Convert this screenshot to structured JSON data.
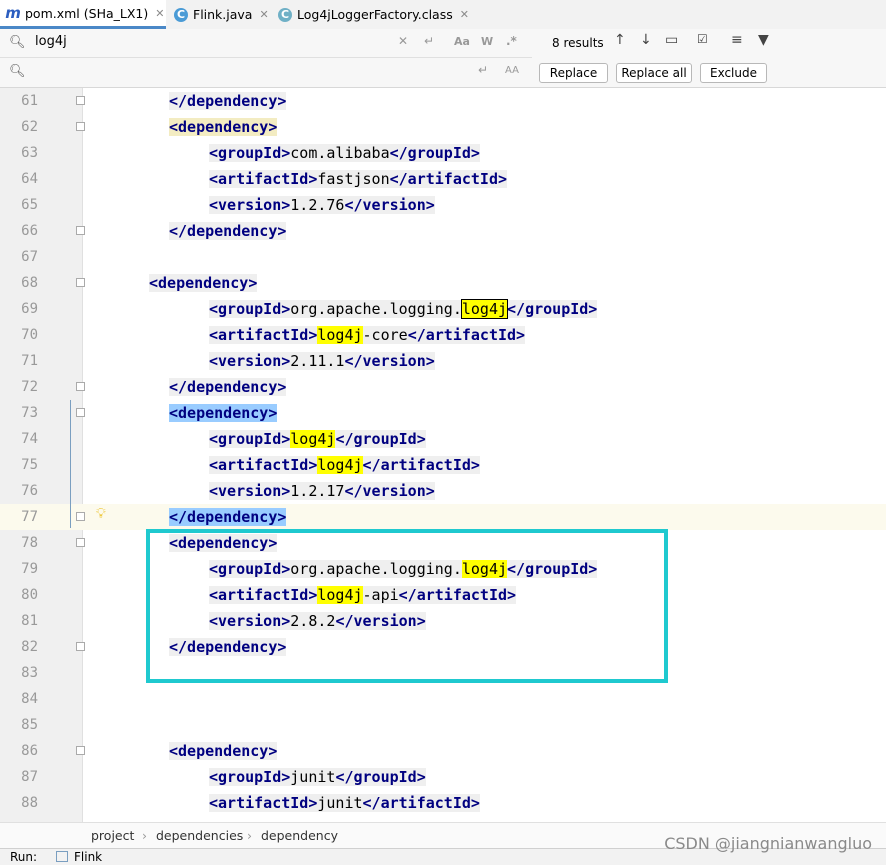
{
  "tabs": [
    {
      "icon": "m",
      "label": "pom.xml (SHa_LX1)",
      "active": true
    },
    {
      "icon": "C",
      "label": "Flink.java",
      "active": false
    },
    {
      "icon": "C",
      "label": "Log4jLoggerFactory.class",
      "active": false
    }
  ],
  "search": {
    "find_value": "log4j",
    "replace_value": "",
    "results": "8 results",
    "match_case": "Aa",
    "words": "W",
    "regex": ".*",
    "preserve_case": "AA",
    "replace_label": "Replace",
    "replace_all_label": "Replace all",
    "exclude_label": "Exclude"
  },
  "editor": {
    "lines": [
      {
        "n": "61",
        "indent": 1,
        "t": [
          [
            "tag",
            "</dependency>"
          ]
        ]
      },
      {
        "n": "62",
        "indent": 1,
        "t": [
          [
            "tagp",
            "<dependency>"
          ]
        ]
      },
      {
        "n": "63",
        "indent": 2,
        "t": [
          [
            "tag",
            "<groupId>"
          ],
          [
            "txt",
            "com.alibaba"
          ],
          [
            "tag",
            "</groupId>"
          ]
        ]
      },
      {
        "n": "64",
        "indent": 2,
        "t": [
          [
            "tag",
            "<artifactId>"
          ],
          [
            "txt",
            "fastjson"
          ],
          [
            "tag",
            "</artifactId>"
          ]
        ]
      },
      {
        "n": "65",
        "indent": 2,
        "t": [
          [
            "tag",
            "<version>"
          ],
          [
            "txt",
            "1.2.76"
          ],
          [
            "tag",
            "</version>"
          ]
        ]
      },
      {
        "n": "66",
        "indent": 1,
        "t": [
          [
            "tag",
            "</dependency>"
          ]
        ]
      },
      {
        "n": "67",
        "indent": 0,
        "t": []
      },
      {
        "n": "68",
        "indent": 0,
        "t": [
          [
            "tag",
            "<dependency>"
          ]
        ]
      },
      {
        "n": "69",
        "indent": 2,
        "t": [
          [
            "tag",
            "<groupId>"
          ],
          [
            "txt",
            "org.apache.logging."
          ],
          [
            "hlb",
            "log4j"
          ],
          [
            "tag",
            "</groupId>"
          ]
        ]
      },
      {
        "n": "70",
        "indent": 2,
        "t": [
          [
            "tag",
            "<artifactId>"
          ],
          [
            "hl",
            "log4j"
          ],
          [
            "txt",
            "-core"
          ],
          [
            "tag",
            "</artifactId>"
          ]
        ]
      },
      {
        "n": "71",
        "indent": 2,
        "t": [
          [
            "tag",
            "<version>"
          ],
          [
            "txt",
            "2.11.1"
          ],
          [
            "tag",
            "</version>"
          ]
        ]
      },
      {
        "n": "72",
        "indent": 1,
        "t": [
          [
            "tag",
            "</dependency>"
          ]
        ]
      },
      {
        "n": "73",
        "indent": 1,
        "t": [
          [
            "tagm",
            "<dependency>"
          ]
        ]
      },
      {
        "n": "74",
        "indent": 2,
        "t": [
          [
            "tag",
            "<groupId>"
          ],
          [
            "hl",
            "log4j"
          ],
          [
            "tag",
            "</groupId>"
          ]
        ]
      },
      {
        "n": "75",
        "indent": 2,
        "t": [
          [
            "tag",
            "<artifactId>"
          ],
          [
            "hl",
            "log4j"
          ],
          [
            "tag",
            "</artifactId>"
          ]
        ]
      },
      {
        "n": "76",
        "indent": 2,
        "t": [
          [
            "tag",
            "<version>"
          ],
          [
            "txt",
            "1.2.17"
          ],
          [
            "tag",
            "</version>"
          ]
        ]
      },
      {
        "n": "77",
        "indent": 1,
        "t": [
          [
            "tagm",
            "</dependency>"
          ]
        ]
      },
      {
        "n": "78",
        "indent": 1,
        "t": [
          [
            "tag",
            "<dependency>"
          ]
        ]
      },
      {
        "n": "79",
        "indent": 2,
        "t": [
          [
            "tag",
            "<groupId>"
          ],
          [
            "txt",
            "org.apache.logging."
          ],
          [
            "hl",
            "log4j"
          ],
          [
            "tag",
            "</groupId>"
          ]
        ]
      },
      {
        "n": "80",
        "indent": 2,
        "t": [
          [
            "tag",
            "<artifactId>"
          ],
          [
            "hl",
            "log4j"
          ],
          [
            "txt",
            "-api"
          ],
          [
            "tag",
            "</artifactId>"
          ]
        ]
      },
      {
        "n": "81",
        "indent": 2,
        "t": [
          [
            "tag",
            "<version>"
          ],
          [
            "txt",
            "2.8.2"
          ],
          [
            "tag",
            "</version>"
          ]
        ]
      },
      {
        "n": "82",
        "indent": 1,
        "t": [
          [
            "tag",
            "</dependency>"
          ]
        ]
      },
      {
        "n": "83",
        "indent": 0,
        "t": []
      },
      {
        "n": "84",
        "indent": 0,
        "t": []
      },
      {
        "n": "85",
        "indent": 0,
        "t": []
      },
      {
        "n": "86",
        "indent": 1,
        "t": [
          [
            "tag",
            "<dependency>"
          ]
        ]
      },
      {
        "n": "87",
        "indent": 2,
        "t": [
          [
            "tag",
            "<groupId>"
          ],
          [
            "txt",
            "junit"
          ],
          [
            "tag",
            "</groupId>"
          ]
        ]
      },
      {
        "n": "88",
        "indent": 2,
        "t": [
          [
            "tag",
            "<artifactId>"
          ],
          [
            "txt",
            "junit"
          ],
          [
            "tag",
            "</artifactId>"
          ]
        ]
      }
    ],
    "caret_line": "77"
  },
  "breadcrumb": [
    "project",
    "dependencies",
    "dependency"
  ],
  "run_bar": {
    "label": "Run:",
    "config": "Flink"
  },
  "watermark": "CSDN @jiangnianwangluo"
}
